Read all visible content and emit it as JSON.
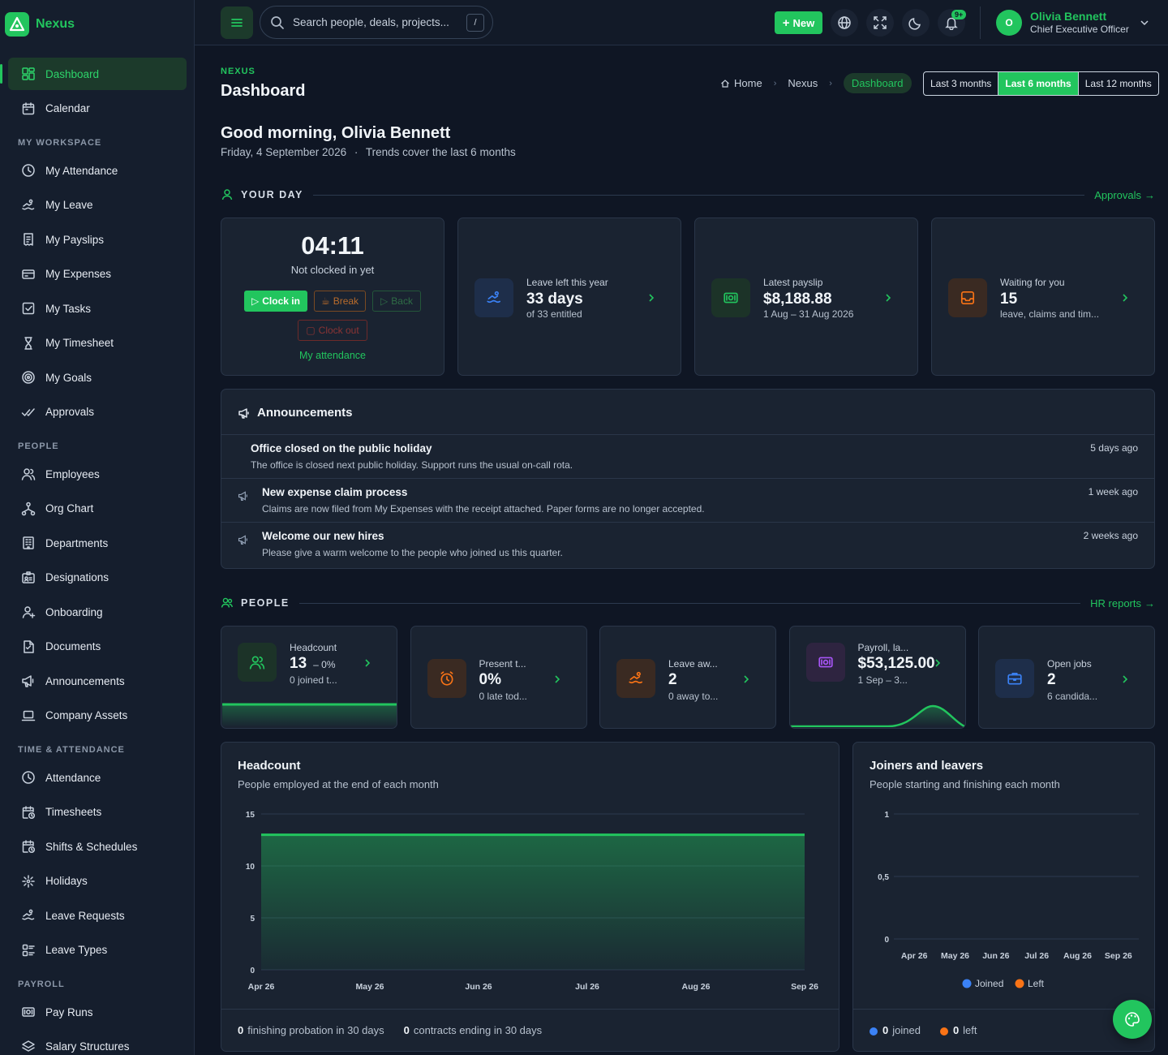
{
  "app": {
    "name": "Nexus"
  },
  "sidebar": {
    "items": [
      {
        "label": "Dashboard",
        "icon": "dashboard-icon",
        "active": true
      },
      {
        "label": "Calendar",
        "icon": "calendar-icon"
      },
      {
        "section": "MY WORKSPACE"
      },
      {
        "label": "My Attendance",
        "icon": "clock-icon"
      },
      {
        "label": "My Leave",
        "icon": "swimmer-icon"
      },
      {
        "label": "My Payslips",
        "icon": "receipt-icon"
      },
      {
        "label": "My Expenses",
        "icon": "card-icon"
      },
      {
        "label": "My Tasks",
        "icon": "checkbox-icon"
      },
      {
        "label": "My Timesheet",
        "icon": "hourglass-icon"
      },
      {
        "label": "My Goals",
        "icon": "target-icon"
      },
      {
        "label": "Approvals",
        "icon": "double-check-icon"
      },
      {
        "section": "PEOPLE"
      },
      {
        "label": "Employees",
        "icon": "users-icon"
      },
      {
        "label": "Org Chart",
        "icon": "hierarchy-icon"
      },
      {
        "label": "Departments",
        "icon": "building-icon"
      },
      {
        "label": "Designations",
        "icon": "id-badge-icon"
      },
      {
        "label": "Onboarding",
        "icon": "user-plus-icon"
      },
      {
        "label": "Documents",
        "icon": "document-icon"
      },
      {
        "label": "Announcements",
        "icon": "megaphone-icon"
      },
      {
        "label": "Company Assets",
        "icon": "laptop-icon"
      },
      {
        "section": "TIME & ATTENDANCE"
      },
      {
        "label": "Attendance",
        "icon": "clock-icon"
      },
      {
        "label": "Timesheets",
        "icon": "calendar-clock-icon"
      },
      {
        "label": "Shifts & Schedules",
        "icon": "calendar-clock-icon"
      },
      {
        "label": "Holidays",
        "icon": "sparkle-icon"
      },
      {
        "label": "Leave Requests",
        "icon": "swimmer-icon"
      },
      {
        "label": "Leave Types",
        "icon": "list-icon"
      },
      {
        "section": "PAYROLL"
      },
      {
        "label": "Pay Runs",
        "icon": "cash-icon"
      },
      {
        "label": "Salary Structures",
        "icon": "layers-icon"
      }
    ]
  },
  "topbar": {
    "search_placeholder": "Search people, deals, projects...",
    "search_shortcut": "/",
    "new_label": "New",
    "notif_badge": "9+",
    "user": {
      "initial": "O",
      "name": "Olivia Bennett",
      "role": "Chief Executive Officer"
    }
  },
  "header": {
    "eyebrow": "NEXUS",
    "title": "Dashboard",
    "breadcrumb": [
      "Home",
      "Nexus",
      "Dashboard"
    ],
    "ranges": [
      "Last 3 months",
      "Last 6 months",
      "Last 12 months"
    ],
    "active_range": "Last 6 months"
  },
  "greeting": {
    "title": "Good morning, Olivia Bennett",
    "date": "Friday, 4 September 2026",
    "trend_note": "Trends cover the last 6 months"
  },
  "your_day": {
    "heading": "YOUR DAY",
    "link": "Approvals",
    "clock": {
      "time": "04:11",
      "status": "Not clocked in yet",
      "clock_in": "Clock in",
      "break": "Break",
      "back": "Back",
      "clock_out": "Clock out",
      "link": "My attendance"
    },
    "stats": [
      {
        "label": "Leave left this year",
        "value": "33 days",
        "sub": "of 33 entitled",
        "color": "#3b82f6"
      },
      {
        "label": "Latest payslip",
        "value": "$8,188.88",
        "sub": "1 Aug – 31 Aug 2026",
        "color": "#22c55e"
      },
      {
        "label": "Waiting for you",
        "value": "15",
        "sub": "leave, claims and tim...",
        "color": "#f97316"
      }
    ]
  },
  "announcements": {
    "title": "Announcements",
    "items": [
      {
        "title": "Office closed on the public holiday",
        "desc": "The office is closed next public holiday. Support runs the usual on-call rota.",
        "ago": "5 days ago"
      },
      {
        "title": "New expense claim process",
        "desc": "Claims are now filed from My Expenses with the receipt attached. Paper forms are no longer accepted.",
        "ago": "1 week ago"
      },
      {
        "title": "Welcome our new hires",
        "desc": "Please give a warm welcome to the people who joined us this quarter.",
        "ago": "2 weeks ago"
      }
    ]
  },
  "people": {
    "heading": "PEOPLE",
    "link": "HR reports",
    "cards": [
      {
        "label": "Headcount",
        "value": "13",
        "delta": "– 0%",
        "sub": "0 joined t...",
        "color": "#22c55e"
      },
      {
        "label": "Present t...",
        "value": "0%",
        "sub": "0 late tod...",
        "color": "#f97316"
      },
      {
        "label": "Leave aw...",
        "value": "2",
        "sub": "0 away to...",
        "color": "#f97316"
      },
      {
        "label": "Payroll, la...",
        "value": "$53,125.00",
        "sub": "1 Sep – 3...",
        "color": "#a855f7"
      },
      {
        "label": "Open jobs",
        "value": "2",
        "sub": "6 candida...",
        "color": "#3b82f6"
      }
    ]
  },
  "headcount_chart": {
    "title": "Headcount",
    "subtitle": "People employed at the end of each month",
    "footer": [
      {
        "value": "0",
        "text": "finishing probation in 30 days"
      },
      {
        "value": "0",
        "text": "contracts ending in 30 days"
      }
    ],
    "chart_data": {
      "type": "area",
      "x": [
        "Apr 26",
        "May 26",
        "Jun 26",
        "Jul 26",
        "Aug 26",
        "Sep 26"
      ],
      "series": [
        {
          "values": [
            13,
            13,
            13,
            13,
            13,
            13
          ],
          "color": "#22c55e"
        }
      ],
      "ylim": [
        0,
        15
      ],
      "yticks": [
        "0",
        "5",
        "10",
        "15"
      ],
      "grid": true
    }
  },
  "joiners_chart": {
    "title": "Joiners and leavers",
    "subtitle": "People starting and finishing each month",
    "footer": [
      {
        "value": "0",
        "text": "joined",
        "color": "#3b82f6"
      },
      {
        "value": "0",
        "text": "left",
        "color": "#f97316"
      }
    ],
    "chart_data": {
      "type": "bar",
      "categories": [
        "Apr 26",
        "May 26",
        "Jun 26",
        "Jul 26",
        "Aug 26",
        "Sep 26"
      ],
      "series": [
        {
          "name": "Joined",
          "values": [
            0,
            0,
            0,
            0,
            0,
            0
          ],
          "color": "#3b82f6"
        },
        {
          "name": "Left",
          "values": [
            0,
            0,
            0,
            0,
            0,
            0
          ],
          "color": "#f97316"
        }
      ],
      "ylim": [
        0,
        1
      ],
      "yticks": [
        "0",
        "0,5",
        "1"
      ],
      "legend": "bottom",
      "grid": true
    }
  }
}
